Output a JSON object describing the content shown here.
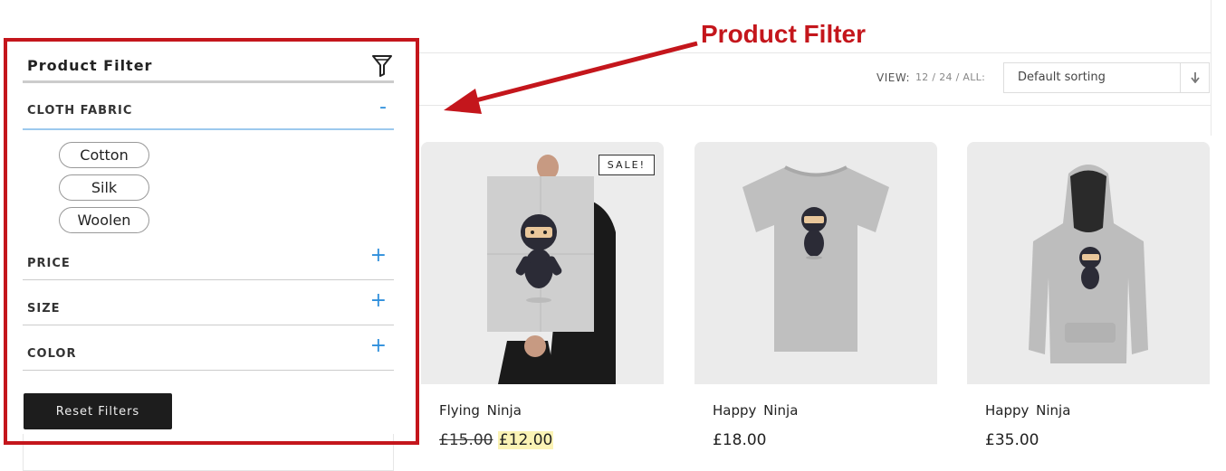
{
  "annotation": {
    "label": "Product Filter"
  },
  "toolbar": {
    "view_label": "VIEW:",
    "view_options": "12 / 24 / ALL:",
    "sort_value": "Default sorting",
    "sort_icon": "arrow-down-icon"
  },
  "filter": {
    "title": "Product Filter",
    "title_icon": "funnel-icon",
    "sections": [
      {
        "label": "CLOTH FABRIC",
        "toggle": "-",
        "expanded": true
      },
      {
        "label": "PRICE",
        "toggle": "+",
        "expanded": false
      },
      {
        "label": "SIZE",
        "toggle": "+",
        "expanded": false
      },
      {
        "label": "COLOR",
        "toggle": "+",
        "expanded": false
      }
    ],
    "fabric_options": [
      "Cotton",
      "Silk",
      "Woolen"
    ],
    "reset_label": "Reset Filters"
  },
  "products": [
    {
      "name": "Flying Ninja",
      "old_price": "£15.00",
      "price": "£12.00",
      "badge": "SALE!",
      "image": "ninja-poster"
    },
    {
      "name": "Happy Ninja",
      "price": "£18.00",
      "image": "ninja-tshirt"
    },
    {
      "name": "Happy Ninja",
      "price": "£35.00",
      "image": "ninja-hoodie"
    }
  ],
  "colors": {
    "accent_red": "#c4161c",
    "toggle_blue": "#2f8fdc",
    "button_dark": "#1d1d1d"
  }
}
